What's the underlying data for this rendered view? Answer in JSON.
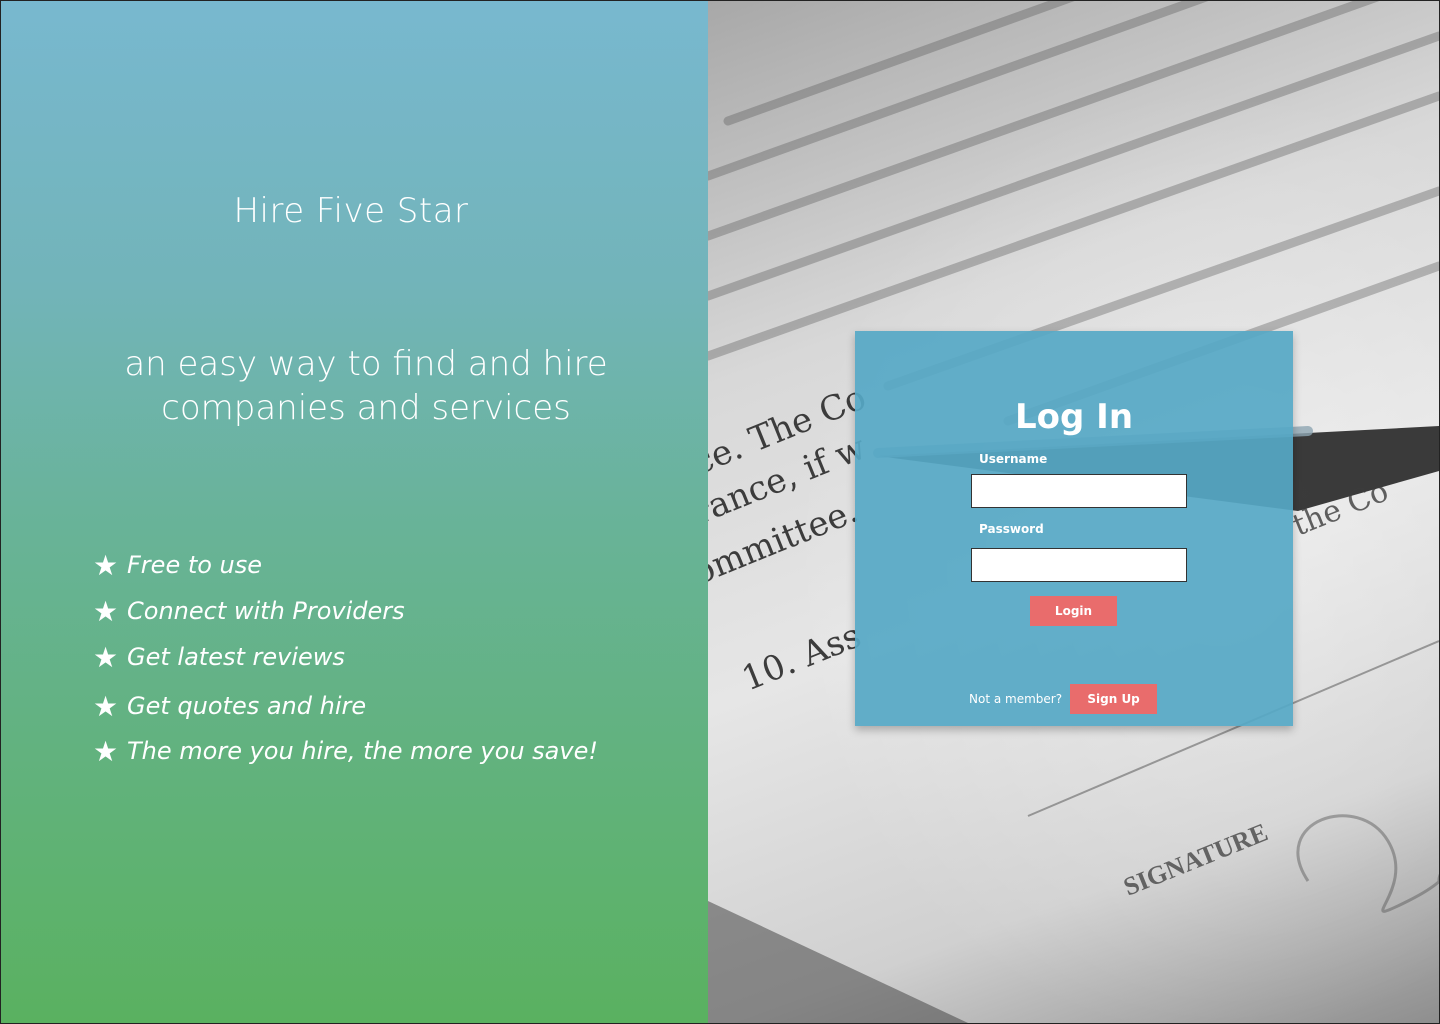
{
  "brand": {
    "title": "Hire Five Star",
    "tagline_line1": "an easy way to find and hire",
    "tagline_line2": "companies and services"
  },
  "features": [
    {
      "icon": "star-icon",
      "label": "Free to use"
    },
    {
      "icon": "star-icon",
      "label": "Connect with Providers"
    },
    {
      "icon": "star-icon",
      "label": "Get latest reviews"
    },
    {
      "icon": "star-icon",
      "label": "Get quotes and hire"
    },
    {
      "icon": "star-icon",
      "label": "The more you hire, the more you save!"
    }
  ],
  "login": {
    "heading": "Log In",
    "username_label": "Username",
    "username_value": "",
    "password_label": "Password",
    "password_value": "",
    "login_button": "Login",
    "not_member_text": "Not a member?",
    "signup_button": "Sign Up"
  },
  "background_document": {
    "lines": [
      "ce. The Co",
      "rance, if w",
      "ommittee.",
      "10. Ass",
      "the Co",
      "SIGNATURE"
    ]
  },
  "colors": {
    "panel_top": "#78b8cf",
    "panel_bottom": "#5ab160",
    "card_bg": "#56a8c6",
    "button": "#e96c6c",
    "text": "#ffffff"
  }
}
